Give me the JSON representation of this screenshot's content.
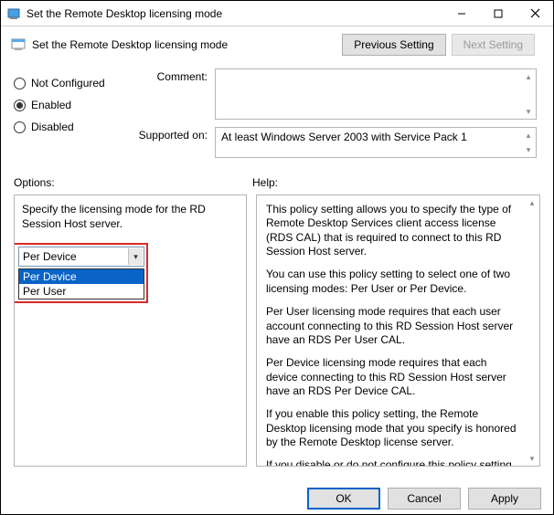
{
  "window": {
    "title": "Set the Remote Desktop licensing mode"
  },
  "header": {
    "title": "Set the Remote Desktop licensing mode",
    "prev_btn": "Previous Setting",
    "next_btn": "Next Setting"
  },
  "radios": {
    "not_configured": "Not Configured",
    "enabled": "Enabled",
    "disabled": "Disabled"
  },
  "fields": {
    "comment_label": "Comment:",
    "supported_label": "Supported on:",
    "supported_value": "At least Windows Server 2003 with Service Pack 1"
  },
  "columns": {
    "options_label": "Options:",
    "help_label": "Help:"
  },
  "options_panel": {
    "instruction": "Specify the licensing mode for the RD Session Host server.",
    "combo_selected": "Per Device",
    "dropdown": {
      "opt1": "Per Device",
      "opt2": "Per User"
    }
  },
  "help_panel": {
    "p1": "This policy setting allows you to specify the type of Remote Desktop Services client access license (RDS CAL) that is required to connect to this RD Session Host server.",
    "p2": "You can use this policy setting to select one of two licensing modes: Per User or Per Device.",
    "p3": "Per User licensing mode requires that each user account connecting to this RD Session Host server have an RDS Per User CAL.",
    "p4": "Per Device licensing mode requires that each device connecting to this RD Session Host server have an RDS Per Device CAL.",
    "p5": "If you enable this policy setting, the Remote Desktop licensing mode that you specify is honored by the Remote Desktop license server.",
    "p6": "If you disable or do not configure this policy setting, the licensing mode is not specified at the Group Policy level."
  },
  "footer": {
    "ok": "OK",
    "cancel": "Cancel",
    "apply": "Apply"
  }
}
